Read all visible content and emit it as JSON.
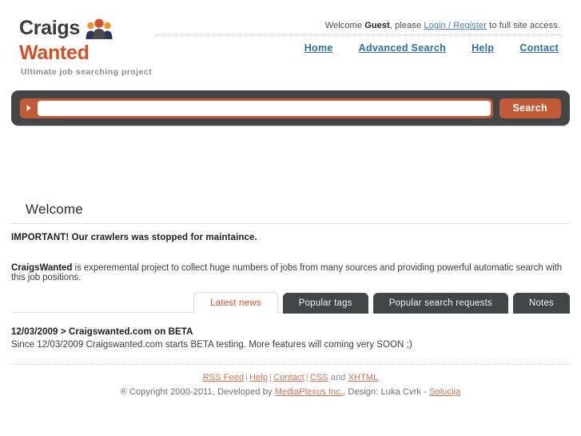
{
  "brand": {
    "name_top": "Craigs",
    "name_bottom": "Wanted",
    "tagline": "Ultimate job searching project",
    "logo_icon": "people-group-icon",
    "color_primary": "#d0502a",
    "color_dark": "#3a3a3a"
  },
  "header": {
    "welcome_prefix": "Welcome ",
    "welcome_user": "Guest",
    "welcome_middle": ", please ",
    "welcome_link": "Login / Register",
    "welcome_suffix": " to full site access.",
    "nav": [
      {
        "label": "Home"
      },
      {
        "label": "Advanced Search"
      },
      {
        "label": "Help"
      },
      {
        "label": "Contact"
      }
    ]
  },
  "search": {
    "arrow_icon": "play-arrow-icon",
    "value": "",
    "placeholder": "",
    "button_label": "Search"
  },
  "main": {
    "section_title": "Welcome",
    "notice": "IMPORTANT! Our crawlers was stopped for maintaince.",
    "intro_bold": "CraigsWanted",
    "intro_text": " is experemental project to collect huge numbers of jobs from many sources and providing powerful automatic search with this job positions."
  },
  "tabs": [
    {
      "label": "Latest news",
      "active": true
    },
    {
      "label": "Popular tags",
      "active": false
    },
    {
      "label": "Popular search requests",
      "active": false
    },
    {
      "label": "Notes",
      "active": false
    }
  ],
  "news": {
    "title": "12/03/2009 > Craigswanted.com on BETA",
    "body": "Since 12/03/2009 Craigswanted.com starts BETA testing. More features will coming very SOON ;)"
  },
  "footer": {
    "links": [
      {
        "label": "RSS Feed"
      },
      {
        "label": "Help"
      },
      {
        "label": "Contact"
      },
      {
        "label": "CSS"
      },
      {
        "label": "XHTML"
      }
    ],
    "sep": "|",
    "and_word": "and",
    "copy_prefix": "® Copyright 2000-2011, Developed by ",
    "copy_link1": "MediaPlexus Inc.",
    "copy_middle": ", Design: Luka Cvrk - ",
    "copy_link2": "Solucija"
  }
}
